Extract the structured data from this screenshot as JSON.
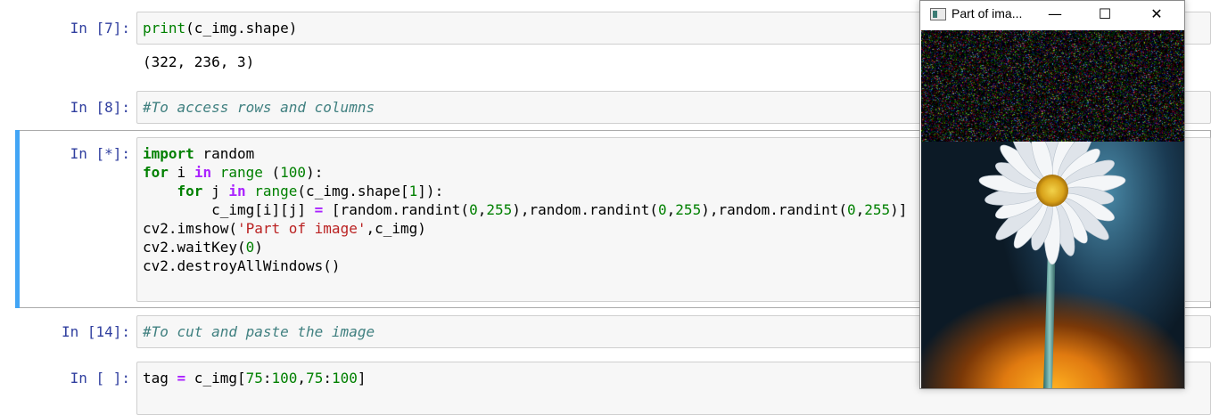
{
  "cells": [
    {
      "prompt": "In [7]:",
      "code": "print(c_img.shape)",
      "output": "(322, 236, 3)"
    },
    {
      "prompt": "In [8]:",
      "comment": "#To access rows and columns"
    },
    {
      "prompt": "In [*]:",
      "lines": [
        "import random",
        "for i in range (100):",
        "for j in range(c_img.shape[1]):",
        "c_img[i][j] = [random.randint(0,255),random.randint(0,255),random.randint(0,255)]",
        "cv2.imshow('Part of image',c_img)",
        "cv2.waitKey(0)",
        "cv2.destroyAllWindows()"
      ]
    },
    {
      "prompt": "In [14]:",
      "comment": "#To cut and paste the image"
    },
    {
      "prompt": "In [ ]:",
      "code": "tag = c_img[75:100,75:100]"
    }
  ],
  "window": {
    "title": "Part of ima...",
    "minimize": "—",
    "maximize": "☐",
    "close": "✕"
  },
  "colors": {
    "prompt": "#303f9f",
    "keyword": "#008000",
    "string": "#ba2121",
    "comment": "#408080",
    "selected_bar": "#42a5f5"
  }
}
